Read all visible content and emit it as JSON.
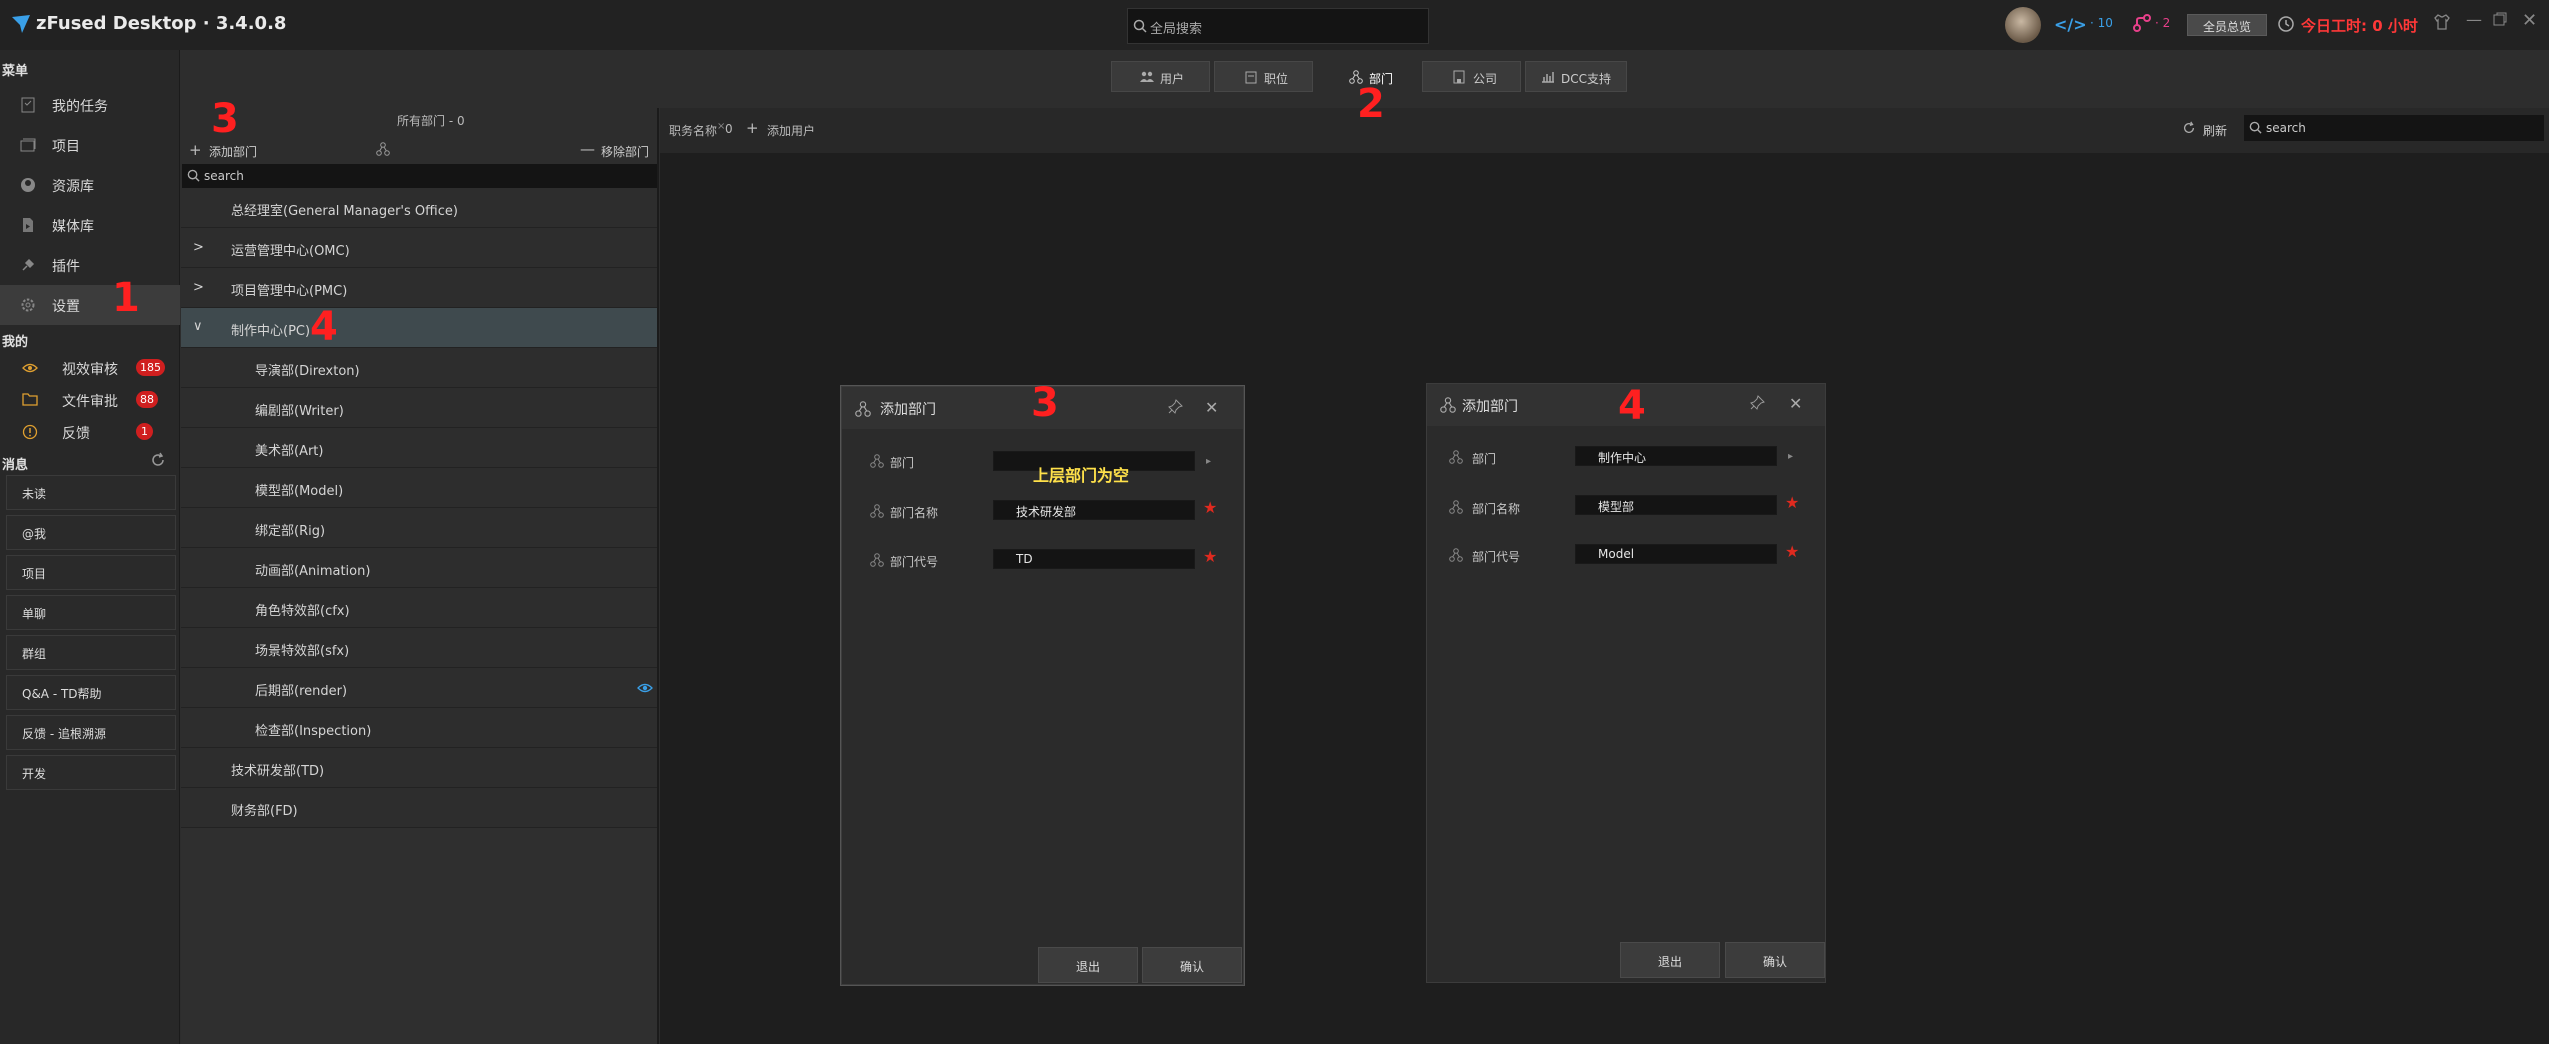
{
  "app": {
    "title": "zFused Desktop · 3.4.0.8"
  },
  "header": {
    "search_placeholder": "全局搜索",
    "code_count": "10",
    "task_count": "2",
    "overview_button": "全员总览",
    "work_hours": "今日工时: 0 小时"
  },
  "sidebar": {
    "menu_title": "菜单",
    "menu_items": [
      {
        "label": "我的任务",
        "icon": "checklist-icon"
      },
      {
        "label": "项目",
        "icon": "folder-stack-icon"
      },
      {
        "label": "资源库",
        "icon": "database-icon"
      },
      {
        "label": "媒体库",
        "icon": "media-file-icon"
      },
      {
        "label": "插件",
        "icon": "plugin-icon"
      },
      {
        "label": "设置",
        "icon": "gear-icon"
      }
    ],
    "mine_title": "我的",
    "mine_items": [
      {
        "label": "视效审核",
        "badge": "185",
        "icon": "eye-icon"
      },
      {
        "label": "文件审批",
        "badge": "88",
        "icon": "folder-icon"
      },
      {
        "label": "反馈",
        "badge": "1",
        "icon": "info-icon"
      }
    ],
    "messages_title": "消息",
    "message_items": [
      "未读",
      "@我",
      "项目",
      "单聊",
      "群组",
      "Q&A - TD帮助",
      "反馈 - 追根溯源",
      "开发"
    ]
  },
  "tabs": [
    {
      "label": "用户"
    },
    {
      "label": "职位"
    },
    {
      "label": "部门"
    },
    {
      "label": "公司"
    },
    {
      "label": "DCC支持"
    }
  ],
  "dept_panel": {
    "add_label": "添加部门",
    "all_label": "所有部门 - 0",
    "remove_label": "移除部门",
    "search_placeholder": "search",
    "departments": [
      {
        "label": "总经理室(General Manager's Office)"
      },
      {
        "label": "运营管理中心(OMC)"
      },
      {
        "label": "项目管理中心(PMC)"
      },
      {
        "label": "制作中心(PC)"
      },
      {
        "label": "导演部(Direxton)"
      },
      {
        "label": "编剧部(Writer)"
      },
      {
        "label": "美术部(Art)"
      },
      {
        "label": "模型部(Model)"
      },
      {
        "label": "绑定部(Rig)"
      },
      {
        "label": "动画部(Animation)"
      },
      {
        "label": "角色特效部(cfx)"
      },
      {
        "label": "场景特效部(sfx)"
      },
      {
        "label": "后期部(render)"
      },
      {
        "label": "检查部(Inspection)"
      },
      {
        "label": "技术研发部(TD)"
      },
      {
        "label": "财务部(FD)"
      }
    ]
  },
  "right_toolbar": {
    "filter_label": "职务名称",
    "filter_count": "0",
    "add_user": "添加用户",
    "refresh": "刷新",
    "search_placeholder": "search"
  },
  "dialog1": {
    "title": "添加部门",
    "parent_label": "部门",
    "parent_value": "",
    "name_label": "部门名称",
    "name_value": "技术研发部",
    "code_label": "部门代号",
    "code_value": "TD",
    "note": "上层部门为空",
    "cancel": "退出",
    "confirm": "确认"
  },
  "dialog2": {
    "title": "添加部门",
    "parent_label": "部门",
    "parent_value": "制作中心",
    "name_label": "部门名称",
    "name_value": "模型部",
    "code_label": "部门代号",
    "code_value": "Model",
    "cancel": "退出",
    "confirm": "确认"
  },
  "annotations": {
    "a1": "1",
    "a2": "2",
    "a3": "3",
    "a4": "4"
  },
  "colors": {
    "accent_red": "#e02a1f",
    "selected_row": "#3f4a4e",
    "note_yellow": "#ffe14a"
  }
}
